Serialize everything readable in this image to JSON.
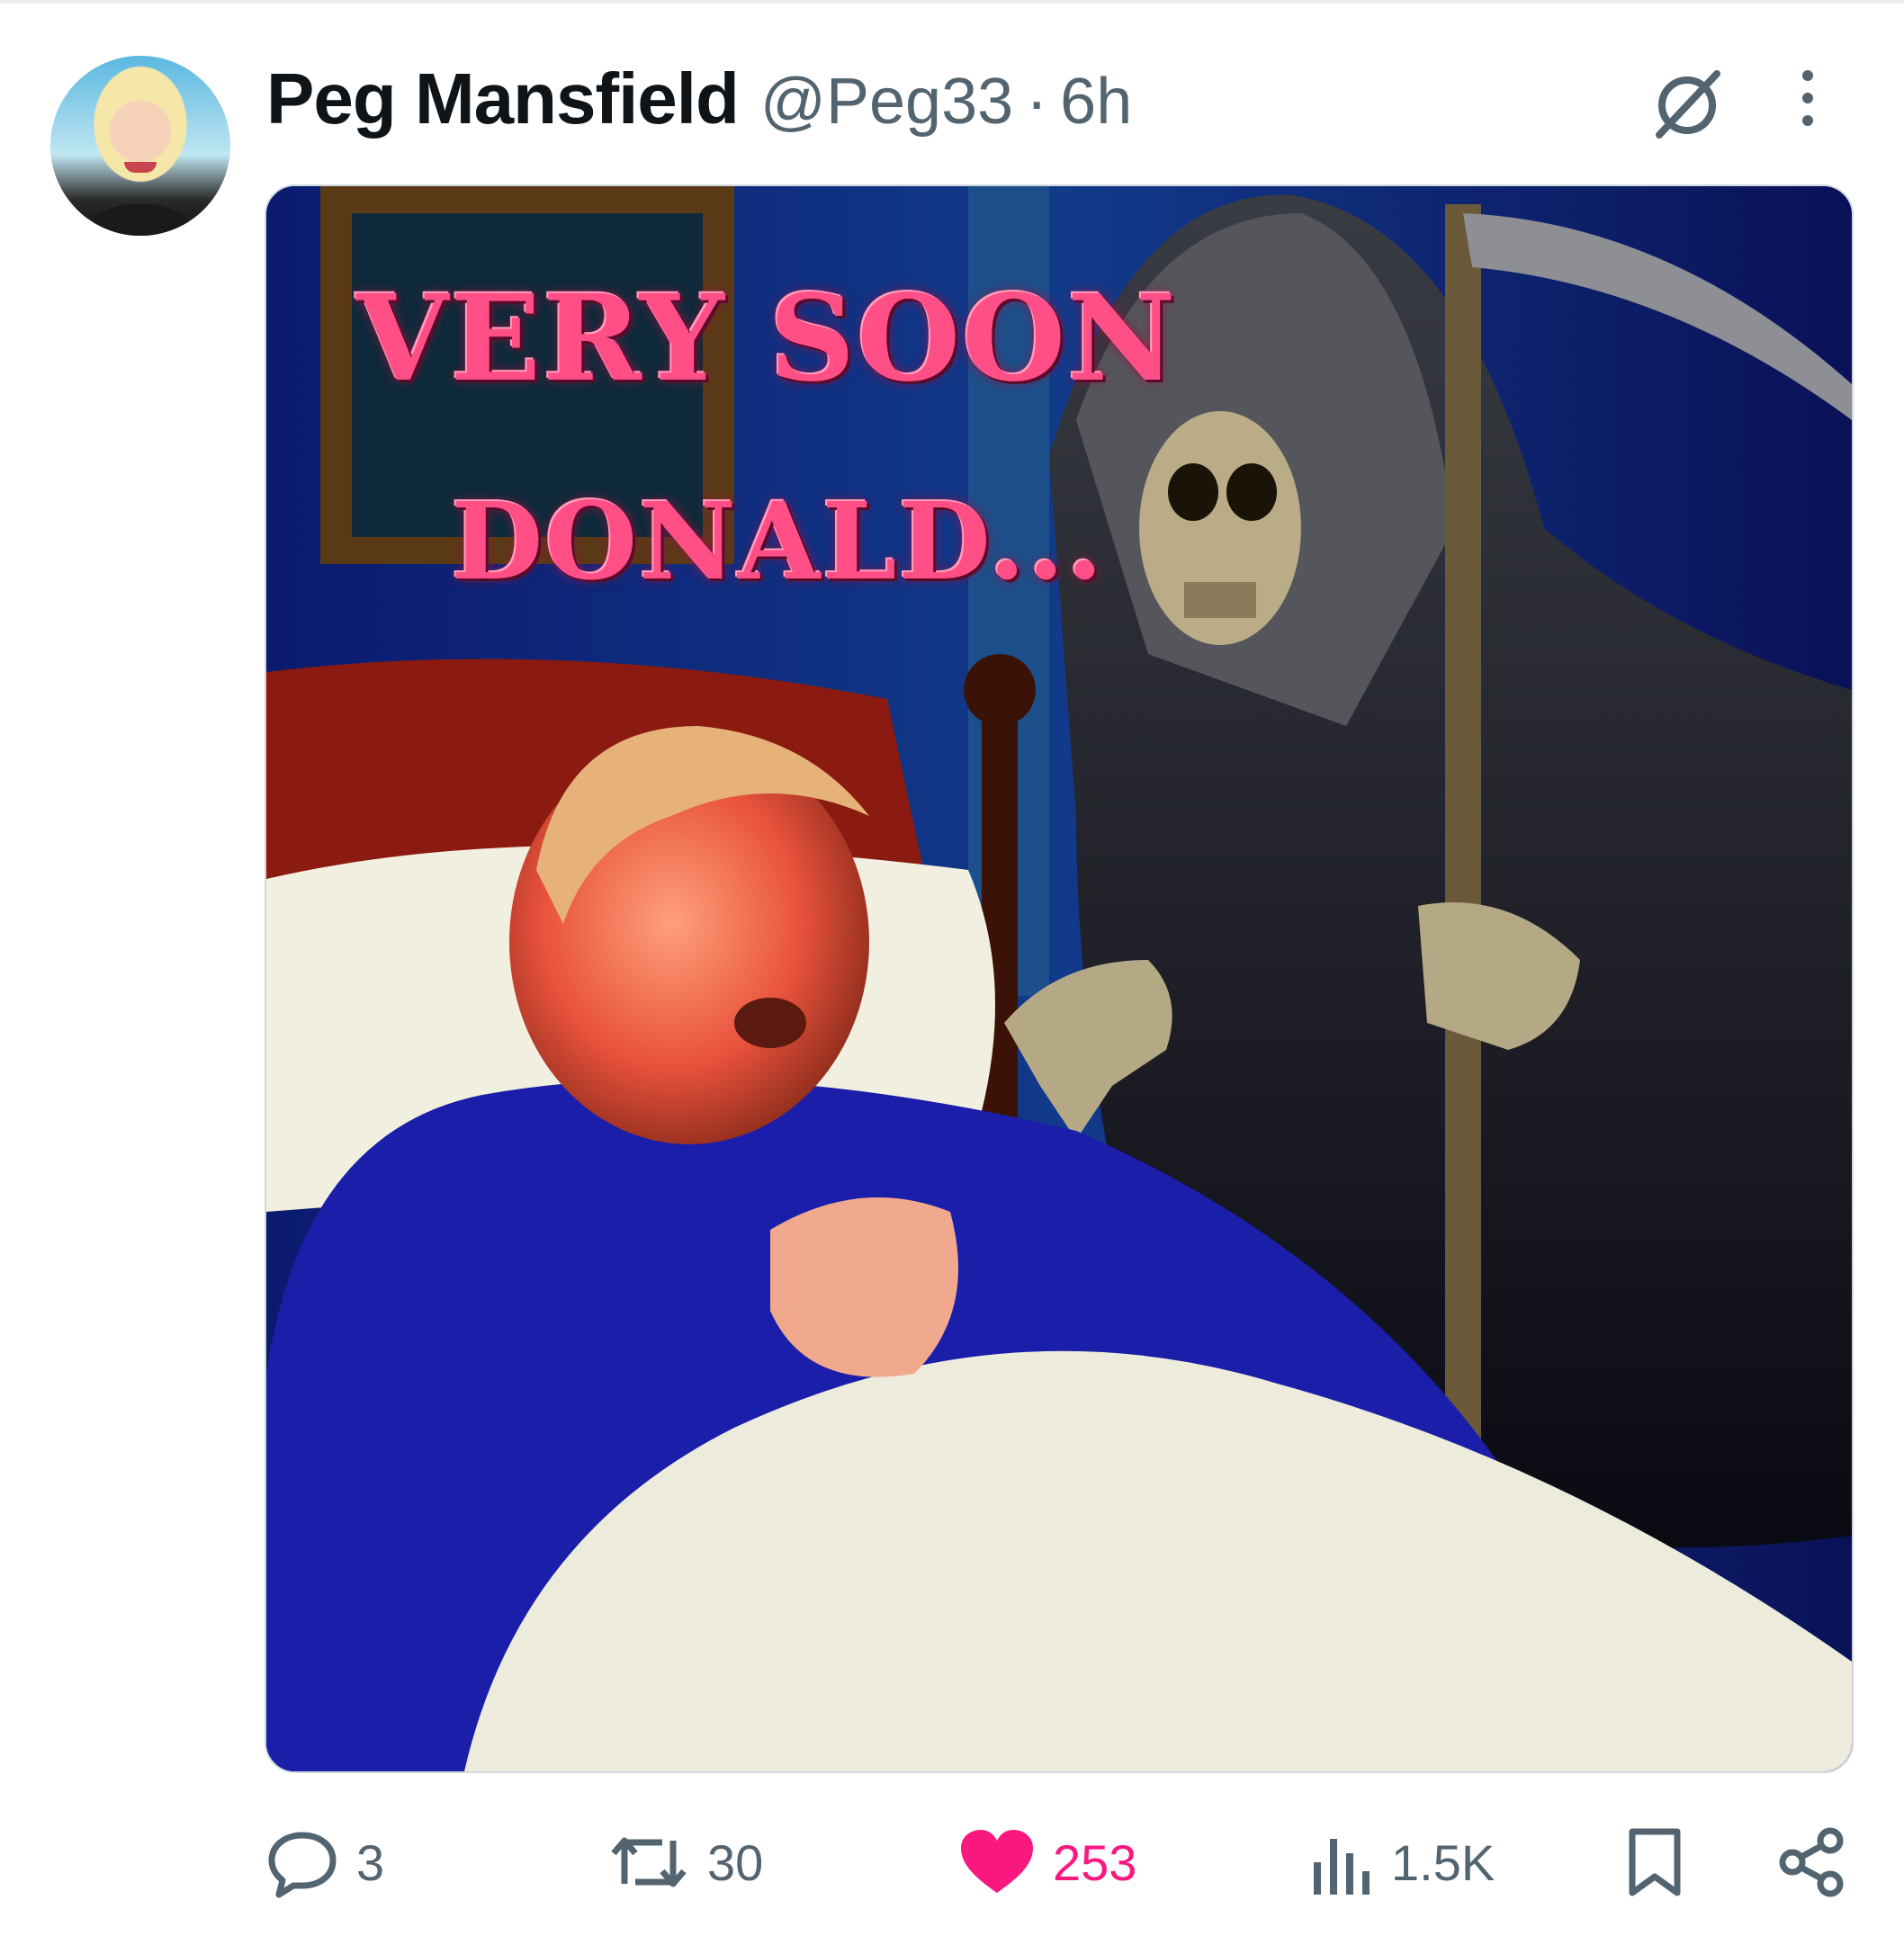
{
  "post": {
    "author": {
      "display_name": "Peg Mansfield",
      "handle": "@Peg33",
      "separator": "·",
      "time": "6h"
    },
    "icons": {
      "grok": "grok-icon",
      "more": "more-dots-icon"
    },
    "media": {
      "overlay_line1": "VERY SOON",
      "overlay_line2": "DONALD..."
    },
    "actions": {
      "reply": {
        "icon": "reply-icon",
        "count": "3"
      },
      "repost": {
        "icon": "repost-icon",
        "count": "30"
      },
      "like": {
        "icon": "heart-icon",
        "count": "253",
        "color": "#f91880"
      },
      "views": {
        "icon": "views-icon",
        "count": "1.5K"
      },
      "bookmark": {
        "icon": "bookmark-icon"
      },
      "share": {
        "icon": "share-icon"
      }
    }
  }
}
